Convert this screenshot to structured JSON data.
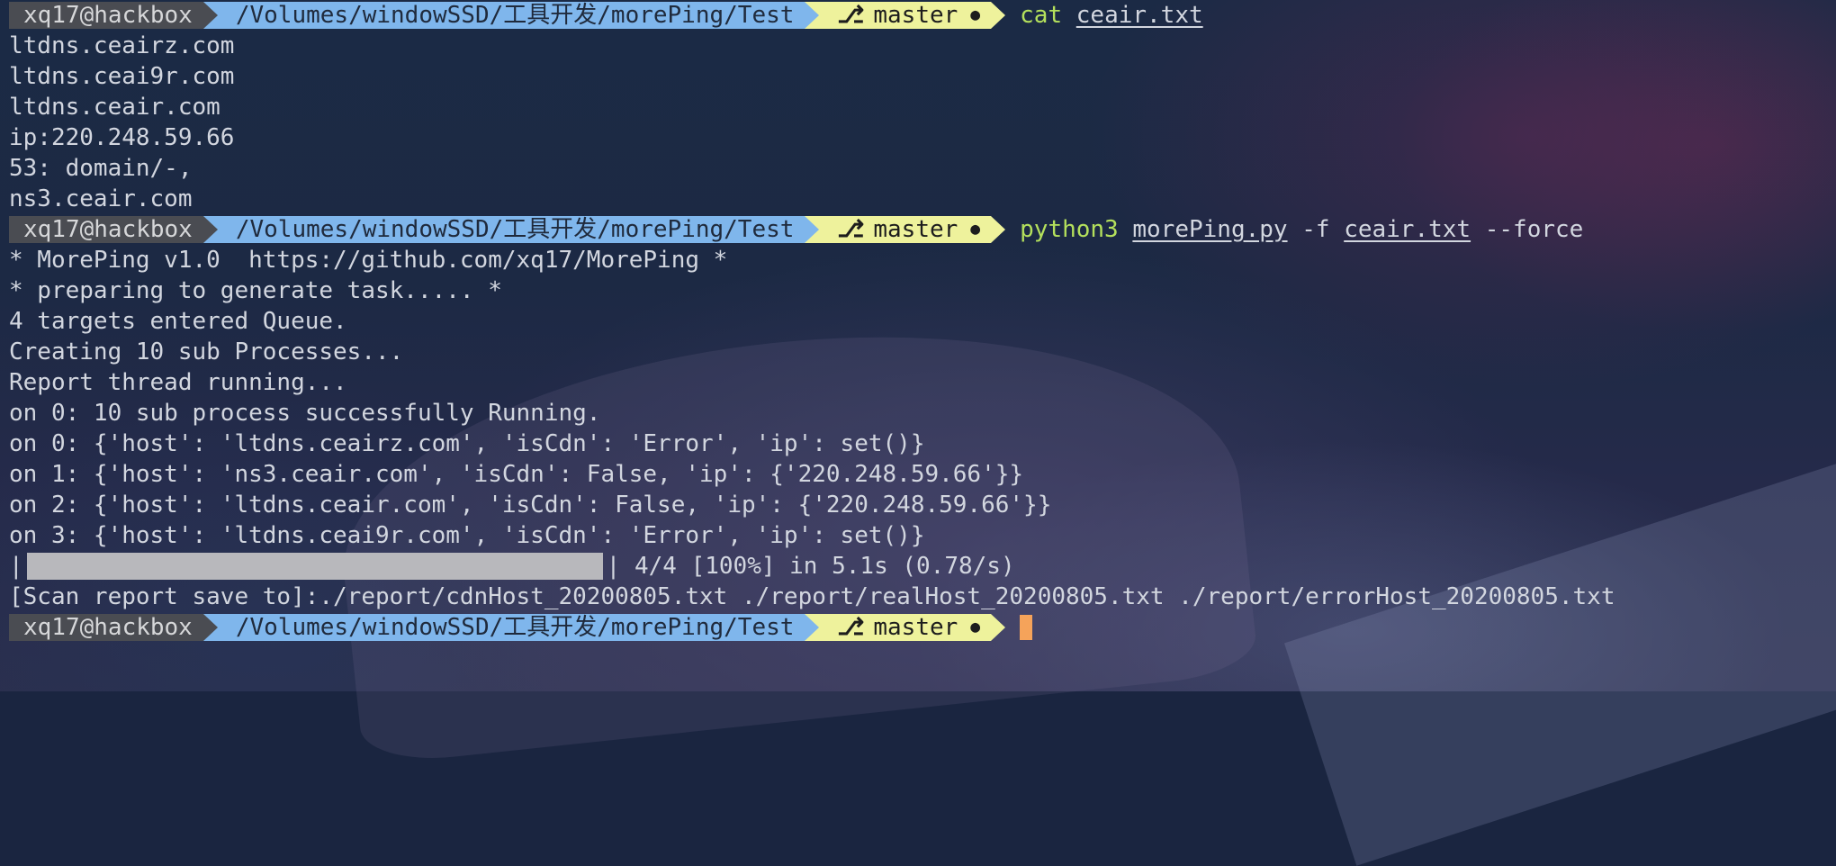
{
  "prompt": {
    "user_host": "xq17@hackbox",
    "path": "/Volumes/windowSSD/工具开发/morePing/Test",
    "branch_icon": "git-branch-icon",
    "branch": "master",
    "dirty_indicator": "●"
  },
  "commands": {
    "cmd1": {
      "name": "cat",
      "arg": "ceair.txt"
    },
    "cmd2": {
      "name": "python3",
      "script": "morePing.py",
      "flag": "-f",
      "file": "ceair.txt",
      "force": "--force"
    }
  },
  "cat_output": [
    "ltdns.ceairz.com",
    "ltdns.ceai9r.com",
    "ltdns.ceair.com",
    "ip:220.248.59.66",
    "53: domain/-,",
    "ns3.ceair.com"
  ],
  "python_output": [
    "* MorePing v1.0  https://github.com/xq17/MorePing *",
    "* preparing to generate task..... *",
    "4 targets entered Queue.",
    "Creating 10 sub Processes...",
    "Report thread running...",
    "on 0: 10 sub process successfully Running.",
    "on 0: {'host': 'ltdns.ceairz.com', 'isCdn': 'Error', 'ip': set()}",
    "on 1: {'host': 'ns3.ceair.com', 'isCdn': False, 'ip': {'220.248.59.66'}}",
    "on 2: {'host': 'ltdns.ceair.com', 'isCdn': False, 'ip': {'220.248.59.66'}}",
    "on 3: {'host': 'ltdns.ceai9r.com', 'isCdn': 'Error', 'ip': set()}"
  ],
  "progress": {
    "left_bar": "|",
    "right_bar": "|",
    "fraction": 1.0,
    "status": " 4/4 [100%] in 5.1s (0.78/s)"
  },
  "report_line": "[Scan report save to]:./report/cdnHost_20200805.txt ./report/realHost_20200805.txt ./report/errorHost_20200805.txt",
  "colors": {
    "user_bg": "#4a4c52",
    "path_bg": "#7fb6ec",
    "git_bg": "#eef29c",
    "command": "#b4e05c",
    "cursor": "#f5a35a"
  }
}
